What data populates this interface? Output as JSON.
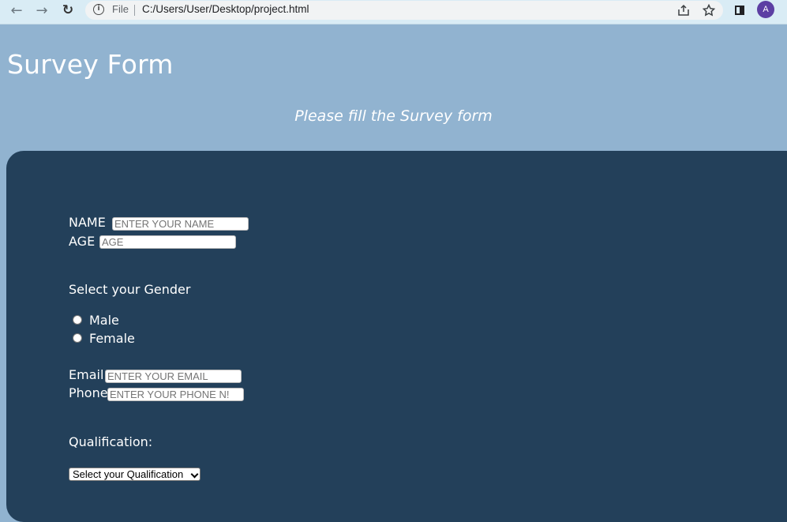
{
  "browser": {
    "file_label": "File",
    "url": "C:/Users/User/Desktop/project.html",
    "avatar_letter": "A",
    "icons": [
      "back-arrow-icon",
      "forward-arrow-icon",
      "reload-icon",
      "info-icon",
      "share-icon",
      "star-icon",
      "side-panel-icon"
    ]
  },
  "page": {
    "title": "Survey Form",
    "subtitle": "Please fill the Survey form",
    "background_color": "#91b3d0",
    "panel_color": "#23405a"
  },
  "form": {
    "name": {
      "label": "NAME",
      "placeholder": "ENTER YOUR NAME",
      "value": ""
    },
    "age": {
      "label": "AGE",
      "placeholder": "AGE",
      "value": ""
    },
    "gender": {
      "heading": "Select your Gender",
      "options": [
        "Male",
        "Female"
      ],
      "selected": null
    },
    "email": {
      "label": "Email",
      "placeholder": "ENTER YOUR EMAIL",
      "value": ""
    },
    "phone": {
      "label": "Phone",
      "placeholder": "ENTER YOUR PHONE N!",
      "value": ""
    },
    "qualification": {
      "heading": "Qualification:",
      "selected": "Select your Qualification"
    }
  }
}
